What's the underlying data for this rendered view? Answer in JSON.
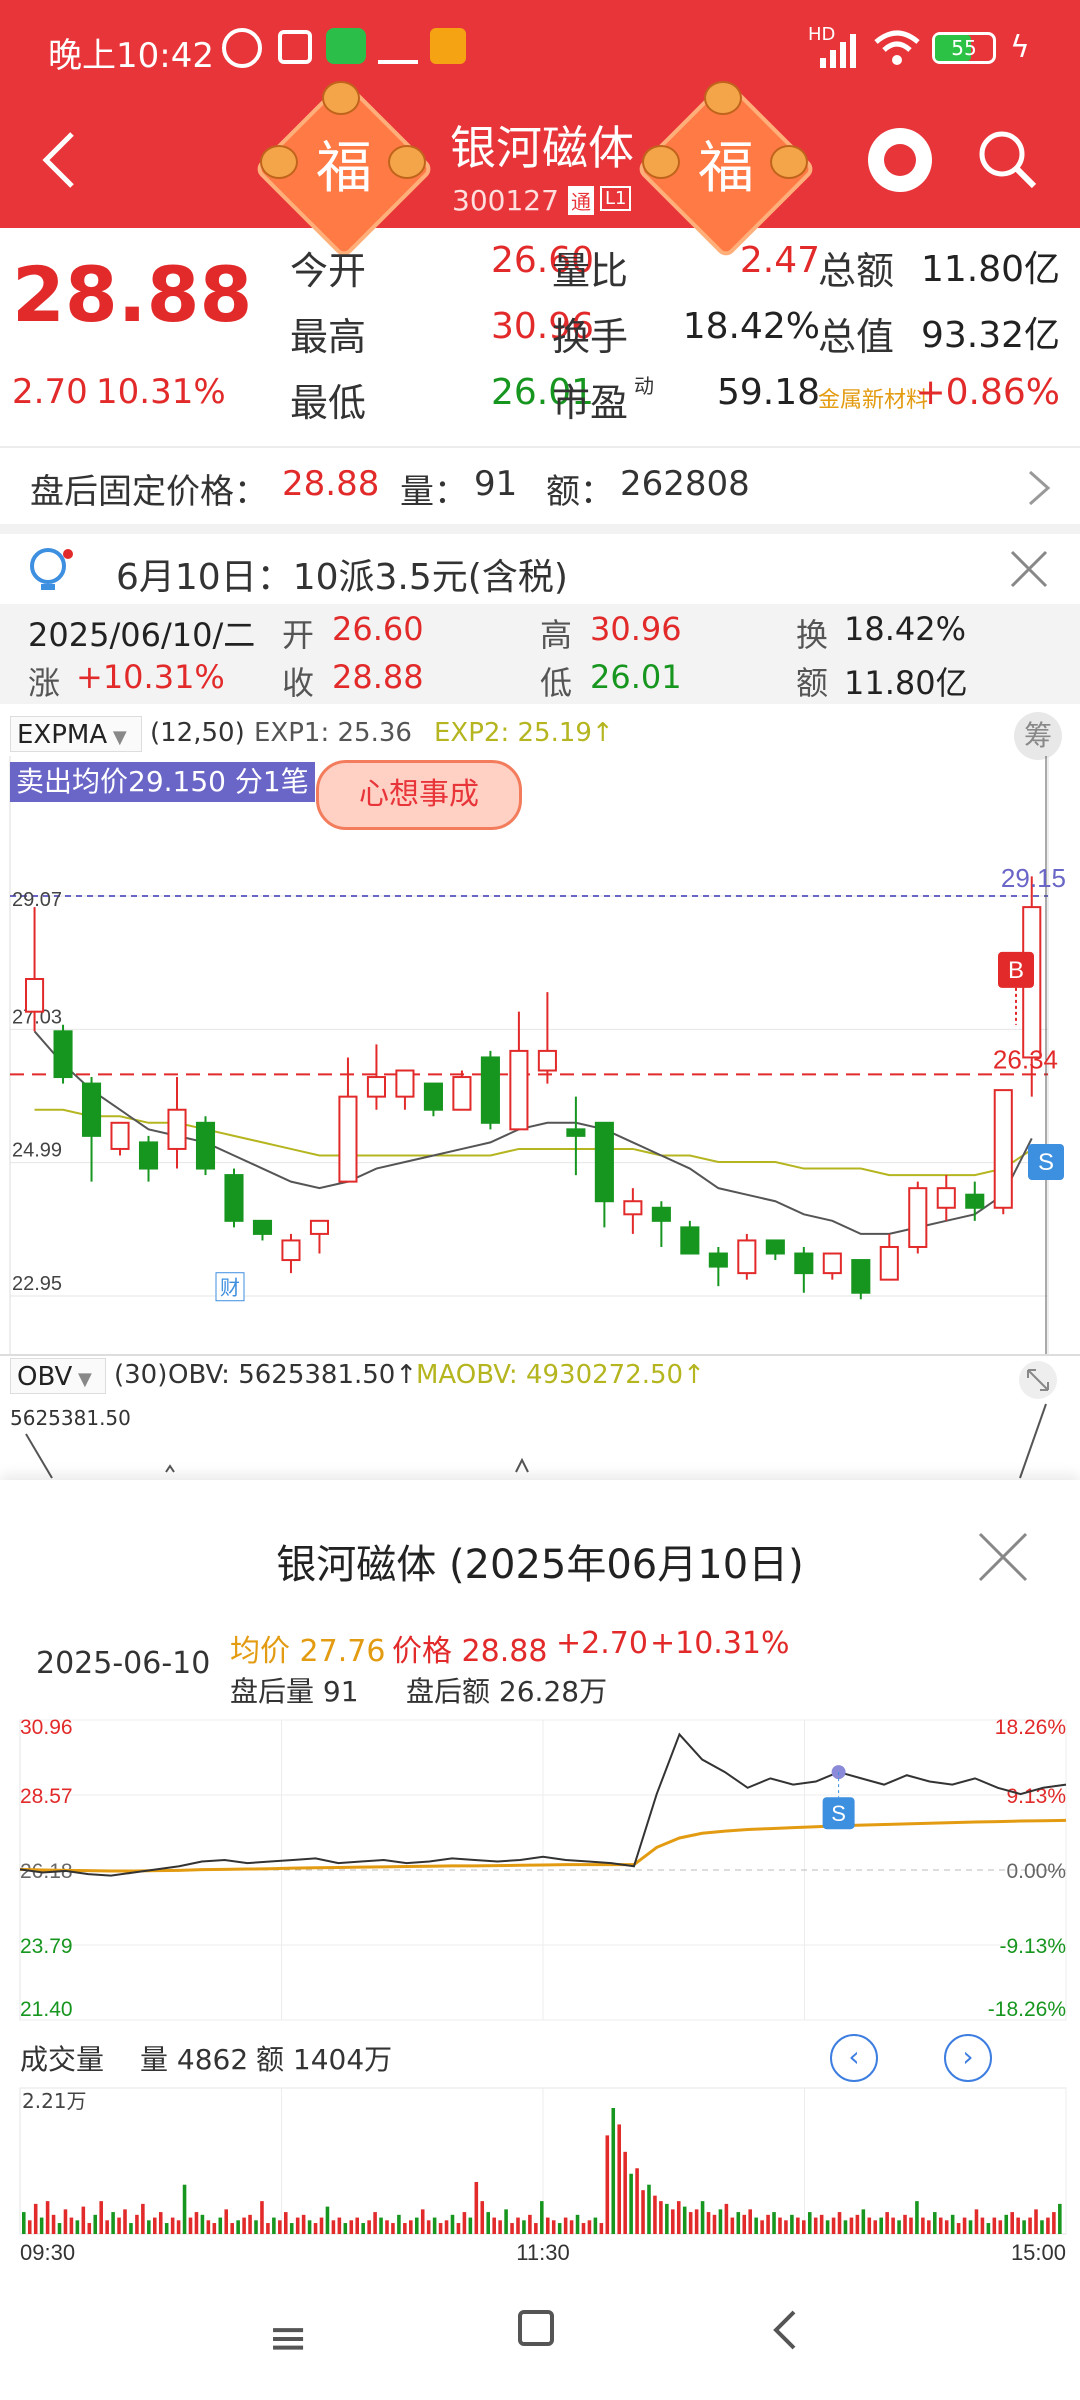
{
  "status_bar": {
    "time": "晚上10:42",
    "battery": "55",
    "network": "HD"
  },
  "header": {
    "title": "银河磁体",
    "code": "300127",
    "tag_tong": "通",
    "tag_level": "L1",
    "fu_char": "福"
  },
  "quote": {
    "price": "28.88",
    "change": "2.70",
    "change_pct": "10.31%",
    "rows": [
      [
        {
          "label": "今开",
          "value": "26.60",
          "color": "red"
        },
        {
          "label": "量比",
          "value": "2.47",
          "color": "red"
        },
        {
          "label": "总额",
          "value": "11.80亿",
          "color": "blk"
        }
      ],
      [
        {
          "label": "最高",
          "value": "30.96",
          "color": "red"
        },
        {
          "label": "换手",
          "value": "18.42%",
          "color": "blk"
        },
        {
          "label": "总值",
          "value": "93.32亿",
          "color": "blk"
        }
      ],
      [
        {
          "label": "最低",
          "value": "26.01",
          "color": "green"
        },
        {
          "label": "市盈",
          "value": "59.18",
          "color": "blk"
        },
        {
          "label": "金属新材料",
          "value": "+0.86%",
          "color": "red"
        }
      ]
    ],
    "pe_superscript": "动"
  },
  "after_hours": {
    "label": "盘后固定价格：",
    "price": "28.88",
    "vol_label": "量：",
    "vol": "91",
    "amt_label": "额：",
    "amt": "262808"
  },
  "notice": {
    "text": "6月10日：10派3.5元(含税)"
  },
  "day_info": {
    "date": "2025/06/10/二",
    "open_label": "开",
    "open": "26.60",
    "high_label": "高",
    "high": "30.96",
    "turn_label": "换",
    "turn": "18.42%",
    "chg_label": "涨",
    "chg": "+10.31%",
    "close_label": "收",
    "close": "28.88",
    "low_label": "低",
    "low": "26.01",
    "amt_label": "额",
    "amt": "11.80亿"
  },
  "kline": {
    "indicator": "EXPMA",
    "params": "(12,50)",
    "exp1": "EXP1: 25.36",
    "exp2": "EXP2: 25.19↑",
    "chip_btn": "筹",
    "sell_avg": "卖出均价29.150 分1笔",
    "sticker": "心想事成",
    "y_labels": [
      "29.07",
      "27.03",
      "24.99",
      "22.95"
    ],
    "price_tag_top": "29.15",
    "price_tag_dash": "26.34",
    "badge_b": "B",
    "badge_s": "S",
    "cai_badge": "财",
    "obv_name": "OBV",
    "obv_params": "(30)",
    "obv_value": "OBV: 5625381.50↑",
    "maobv_value": "MAOBV: 4930272.50↑",
    "obv_axis": "5625381.50"
  },
  "chart_data": [
    {
      "type": "candlestick",
      "title": "",
      "ylim": [
        22.95,
        29.07
      ],
      "candles": [
        [
          27.3,
          27.8,
          28.9,
          27.0
        ],
        [
          27.0,
          26.3,
          27.1,
          26.2
        ],
        [
          26.2,
          25.4,
          26.3,
          24.7
        ],
        [
          25.2,
          25.6,
          25.6,
          25.1
        ],
        [
          25.3,
          24.9,
          25.4,
          24.7
        ],
        [
          25.2,
          25.8,
          26.3,
          24.9
        ],
        [
          25.6,
          24.9,
          25.7,
          24.8
        ],
        [
          24.8,
          24.1,
          24.9,
          24.0
        ],
        [
          24.1,
          23.9,
          24.1,
          23.8
        ],
        [
          23.5,
          23.8,
          23.9,
          23.3
        ],
        [
          23.9,
          24.1,
          24.1,
          23.6
        ],
        [
          24.7,
          26.0,
          26.6,
          24.7
        ],
        [
          26.0,
          26.3,
          26.8,
          25.8
        ],
        [
          26.0,
          26.4,
          26.4,
          25.8
        ],
        [
          26.2,
          25.8,
          26.2,
          25.7
        ],
        [
          25.8,
          26.3,
          26.4,
          25.8
        ],
        [
          26.6,
          25.6,
          26.7,
          25.5
        ],
        [
          25.5,
          26.7,
          27.3,
          25.5
        ],
        [
          26.4,
          26.7,
          27.6,
          26.2
        ],
        [
          25.5,
          25.4,
          26.0,
          24.8
        ],
        [
          25.6,
          24.4,
          25.6,
          24.0
        ],
        [
          24.2,
          24.4,
          24.6,
          23.9
        ],
        [
          24.3,
          24.1,
          24.4,
          23.7
        ],
        [
          24.0,
          23.6,
          24.1,
          23.6
        ],
        [
          23.6,
          23.4,
          23.7,
          23.1
        ],
        [
          23.3,
          23.8,
          23.9,
          23.2
        ],
        [
          23.8,
          23.6,
          23.8,
          23.5
        ],
        [
          23.6,
          23.3,
          23.7,
          23.0
        ],
        [
          23.3,
          23.6,
          23.6,
          23.2
        ],
        [
          23.5,
          23.0,
          23.5,
          22.9
        ],
        [
          23.2,
          23.7,
          23.9,
          23.2
        ],
        [
          23.7,
          24.6,
          24.7,
          23.6
        ],
        [
          24.3,
          24.6,
          24.8,
          24.1
        ],
        [
          24.5,
          24.3,
          24.7,
          24.1
        ],
        [
          24.3,
          26.1,
          26.0,
          24.2
        ],
        [
          26.6,
          28.9,
          30.96,
          26.0
        ]
      ],
      "exp1": [
        27.0,
        26.5,
        26.1,
        25.8,
        25.5,
        25.4,
        25.3,
        25.1,
        24.9,
        24.7,
        24.6,
        24.7,
        24.9,
        25.0,
        25.1,
        25.2,
        25.3,
        25.5,
        25.6,
        25.6,
        25.5,
        25.3,
        25.1,
        24.9,
        24.6,
        24.5,
        24.4,
        24.2,
        24.1,
        23.9,
        23.9,
        24.0,
        24.1,
        24.2,
        24.5,
        25.36
      ],
      "exp2": [
        25.8,
        25.8,
        25.7,
        25.7,
        25.6,
        25.6,
        25.5,
        25.4,
        25.3,
        25.2,
        25.1,
        25.1,
        25.1,
        25.1,
        25.1,
        25.1,
        25.1,
        25.2,
        25.2,
        25.2,
        25.2,
        25.2,
        25.1,
        25.1,
        25.0,
        25.0,
        25.0,
        24.9,
        24.9,
        24.9,
        24.8,
        24.8,
        24.8,
        24.8,
        24.9,
        25.19
      ]
    },
    {
      "type": "line",
      "title": "银河磁体 (2025年06月10日)",
      "date": "2025-06-10",
      "avg_label": "均价",
      "avg": "27.76",
      "price_label": "价格",
      "price": "28.88",
      "chg": "+2.70",
      "chg_pct": "+10.31%",
      "ah_vol_label": "盘后量",
      "ah_vol": "91",
      "ah_amt_label": "盘后额",
      "ah_amt": "26.28万",
      "y_left": [
        "30.96",
        "28.57",
        "26.18",
        "23.79",
        "21.40"
      ],
      "y_right": [
        "18.26%",
        "9.13%",
        "0.00%",
        "-9.13%",
        "-18.26%"
      ],
      "ylim": [
        21.4,
        30.96
      ],
      "x_labels": [
        "09:30",
        "11:30",
        "15:00"
      ],
      "price_series": [
        26.2,
        26.1,
        26.15,
        26.05,
        26.0,
        26.1,
        26.2,
        26.3,
        26.45,
        26.5,
        26.4,
        26.45,
        26.5,
        26.55,
        26.4,
        26.45,
        26.5,
        26.4,
        26.45,
        26.55,
        26.5,
        26.45,
        26.5,
        26.6,
        26.5,
        26.45,
        26.4,
        26.3,
        28.6,
        30.5,
        29.7,
        29.3,
        28.8,
        29.1,
        28.9,
        29.0,
        29.3,
        29.1,
        28.9,
        29.2,
        29.0,
        28.9,
        29.1,
        28.8,
        28.6,
        28.8,
        28.9
      ],
      "avg_series": [
        26.2,
        26.18,
        26.17,
        26.16,
        26.15,
        26.15,
        26.16,
        26.17,
        26.19,
        26.2,
        26.21,
        26.22,
        26.24,
        26.25,
        26.26,
        26.27,
        26.28,
        26.29,
        26.3,
        26.31,
        26.31,
        26.32,
        26.33,
        26.34,
        26.35,
        26.35,
        26.35,
        26.35,
        26.9,
        27.2,
        27.35,
        27.42,
        27.47,
        27.5,
        27.53,
        27.56,
        27.59,
        27.61,
        27.63,
        27.65,
        27.67,
        27.69,
        27.71,
        27.72,
        27.74,
        27.75,
        27.76
      ],
      "badge_s": "S",
      "vol_title": "成交量",
      "vol_label": "量",
      "vol": "4862",
      "amt_label": "额",
      "amt": "1404万",
      "vol_max": "2.21万",
      "volumes": [
        40,
        25,
        55,
        30,
        60,
        35,
        20,
        45,
        30,
        25,
        50,
        20,
        35,
        60,
        25,
        40,
        30,
        45,
        20,
        35,
        55,
        25,
        30,
        40,
        20,
        30,
        25,
        90,
        30,
        40,
        35,
        25,
        20,
        30,
        45,
        20,
        25,
        30,
        35,
        25,
        60,
        20,
        30,
        25,
        40,
        20,
        30,
        35,
        25,
        20,
        30,
        50,
        25,
        30,
        20,
        25,
        30,
        20,
        25,
        40,
        30,
        25,
        20,
        35,
        20,
        25,
        30,
        45,
        25,
        30,
        20,
        25,
        35,
        20,
        40,
        30,
        95,
        60,
        40,
        30,
        25,
        45,
        20,
        30,
        25,
        35,
        20,
        60,
        30,
        25,
        20,
        30,
        25,
        35,
        20,
        25,
        30,
        20,
        180,
        230,
        200,
        150,
        110,
        120,
        80,
        90,
        70,
        60,
        55,
        45,
        60,
        50,
        40,
        45,
        60,
        40,
        35,
        45,
        55,
        30,
        40,
        35,
        45,
        30,
        25,
        35,
        40,
        30,
        25,
        35,
        30,
        25,
        40,
        30,
        35,
        25,
        30,
        40,
        25,
        30,
        35,
        45,
        30,
        25,
        30,
        40,
        30,
        25,
        35,
        30,
        60,
        30,
        25,
        40,
        30,
        25,
        35,
        20,
        30,
        25,
        45,
        30,
        20,
        30,
        25,
        35,
        40,
        30,
        25,
        30,
        45,
        25,
        30,
        40,
        55
      ]
    }
  ],
  "nav": {
    "left": "≡",
    "home": "□",
    "back": "<"
  },
  "colors": {
    "header_red": "#e8353a",
    "up": "#e22a2a",
    "down": "#17961f",
    "exp1": "#555555",
    "exp2": "#b5b520",
    "avg_line": "#e39b12",
    "badge_blue": "#3d8fe0"
  }
}
